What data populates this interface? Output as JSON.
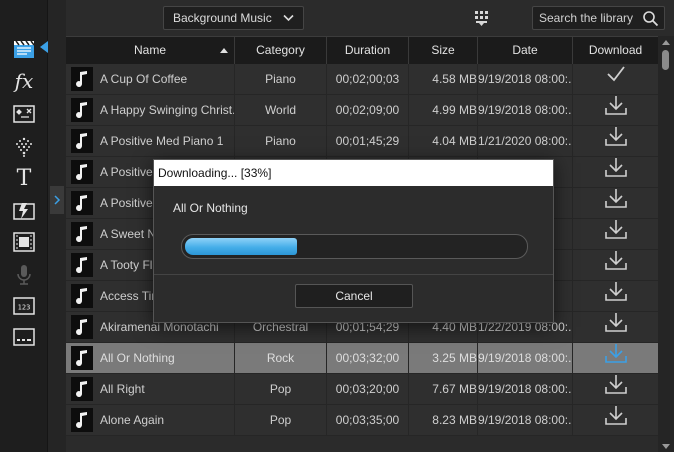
{
  "topbar": {
    "category_select": "Background Music",
    "search_placeholder": "Search the library"
  },
  "table": {
    "columns": {
      "name": "Name",
      "category": "Category",
      "duration": "Duration",
      "size": "Size",
      "date": "Date",
      "download": "Download"
    },
    "sort": {
      "column": "Name",
      "direction": "ascending"
    },
    "rows": [
      {
        "name": "A Cup Of Coffee",
        "category": "Piano",
        "duration": "00;02;00;03",
        "size": "4.58 MB",
        "date": "9/19/2018 08:00:...",
        "status": "downloaded"
      },
      {
        "name": "A Happy Swinging Christ...",
        "category": "World",
        "duration": "00;02;09;00",
        "size": "4.99 MB",
        "date": "9/19/2018 08:00:...",
        "status": "available"
      },
      {
        "name": "A Positive Med Piano 1",
        "category": "Piano",
        "duration": "00;01;45;29",
        "size": "4.04 MB",
        "date": "1/21/2020 08:00:...",
        "status": "available"
      },
      {
        "name": "A Positive",
        "category": "",
        "duration": "",
        "size": "",
        "date": "",
        "status": "available"
      },
      {
        "name": "A Positive",
        "category": "",
        "duration": "",
        "size": "",
        "date": "",
        "status": "available"
      },
      {
        "name": "A Sweet N",
        "category": "",
        "duration": "",
        "size": "",
        "date": "",
        "status": "available"
      },
      {
        "name": "A Tooty Fl",
        "category": "",
        "duration": "",
        "size": "",
        "date": "",
        "status": "available"
      },
      {
        "name": "Access Tin",
        "category": "",
        "duration": "",
        "size": "",
        "date": "",
        "status": "available"
      },
      {
        "name": "Akiramenai Monotachi",
        "category": "Orchestral",
        "duration": "00;01;54;29",
        "size": "4.40 MB",
        "date": "1/22/2019 08:00:...",
        "status": "available"
      },
      {
        "name": "All Or Nothing",
        "category": "Rock",
        "duration": "00;03;32;00",
        "size": "3.25 MB",
        "date": "9/19/2018 08:00:...",
        "status": "downloading"
      },
      {
        "name": "All Right",
        "category": "Pop",
        "duration": "00;03;20;00",
        "size": "7.67 MB",
        "date": "9/19/2018 08:00:...",
        "status": "available"
      },
      {
        "name": "Alone Again",
        "category": "Pop",
        "duration": "00;03;35;00",
        "size": "8.23 MB",
        "date": "9/19/2018 08:00:...",
        "status": "available"
      }
    ]
  },
  "dialog": {
    "title": "Downloading... [33%]",
    "file_name": "All Or Nothing",
    "progress": 0.33,
    "cancel_label": "Cancel"
  },
  "colors": {
    "accent": "#3ba0e6",
    "selected_row": "#7a7a7a",
    "progress_fill": "#45aee9"
  }
}
